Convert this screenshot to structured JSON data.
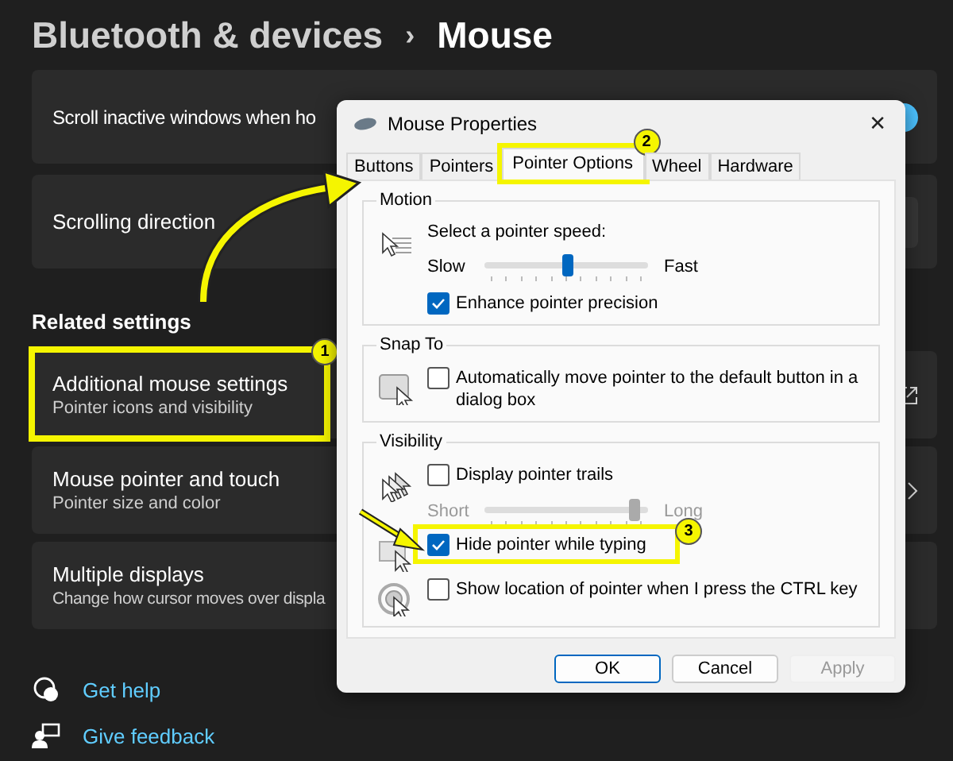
{
  "header": {
    "parent": "Bluetooth & devices",
    "separator": "›",
    "title": "Mouse"
  },
  "cards": [
    {
      "title": "Scroll inactive windows when ho",
      "kind": "toggle",
      "on": true
    },
    {
      "title": "Scrolling direction",
      "kind": "dropdown"
    }
  ],
  "related_heading": "Related settings",
  "related": [
    {
      "title": "Additional mouse settings",
      "subtitle": "Pointer icons and visibility",
      "kind": "external",
      "highlight": "1"
    },
    {
      "title": "Mouse pointer and touch",
      "subtitle": "Pointer size and color",
      "kind": "chevron"
    },
    {
      "title": "Multiple displays",
      "subtitle": "Change how cursor moves over displa",
      "kind": "plain"
    }
  ],
  "links": [
    {
      "label": "Get help"
    },
    {
      "label": "Give feedback"
    }
  ],
  "dialog": {
    "title": "Mouse Properties",
    "close": "✕",
    "tabs": [
      {
        "label": "Buttons",
        "selected": false
      },
      {
        "label": "Pointers",
        "selected": false
      },
      {
        "label": "Pointer Options",
        "selected": true,
        "highlight": "2"
      },
      {
        "label": "Wheel",
        "selected": false
      },
      {
        "label": "Hardware",
        "selected": false
      }
    ],
    "groups": [
      {
        "legend": "Motion",
        "blocks": [
          {
            "rows": [
              {
                "kind": "label",
                "text": "Select a pointer speed:"
              },
              {
                "kind": "slider",
                "min_label": "Slow",
                "max_label": "Fast",
                "level": 0.5,
                "disabled": false
              },
              {
                "kind": "checkbox",
                "label": "Enhance pointer precision",
                "checked": true
              }
            ]
          }
        ]
      },
      {
        "legend": "Snap To",
        "blocks": [
          {
            "rows": [
              {
                "kind": "checkbox",
                "label": "Automatically move pointer to the default button in a dialog box",
                "checked": false
              }
            ]
          }
        ]
      },
      {
        "legend": "Visibility",
        "blocks": [
          {
            "rows": [
              {
                "kind": "checkbox",
                "label": "Display pointer trails",
                "checked": false
              },
              {
                "kind": "slider",
                "min_label": "Short",
                "max_label": "Long",
                "level": 0.95,
                "disabled": true
              }
            ]
          },
          {
            "rows": [
              {
                "kind": "checkbox",
                "label": "Hide pointer while typing",
                "checked": true,
                "highlight": "3"
              }
            ]
          },
          {
            "rows": [
              {
                "kind": "checkbox",
                "label": "Show location of pointer when I press the CTRL key",
                "checked": false
              }
            ]
          }
        ]
      }
    ],
    "buttons": [
      {
        "label": "OK",
        "default": true,
        "disabled": false
      },
      {
        "label": "Cancel",
        "default": false,
        "disabled": false
      },
      {
        "label": "Apply",
        "default": false,
        "disabled": true
      }
    ]
  }
}
